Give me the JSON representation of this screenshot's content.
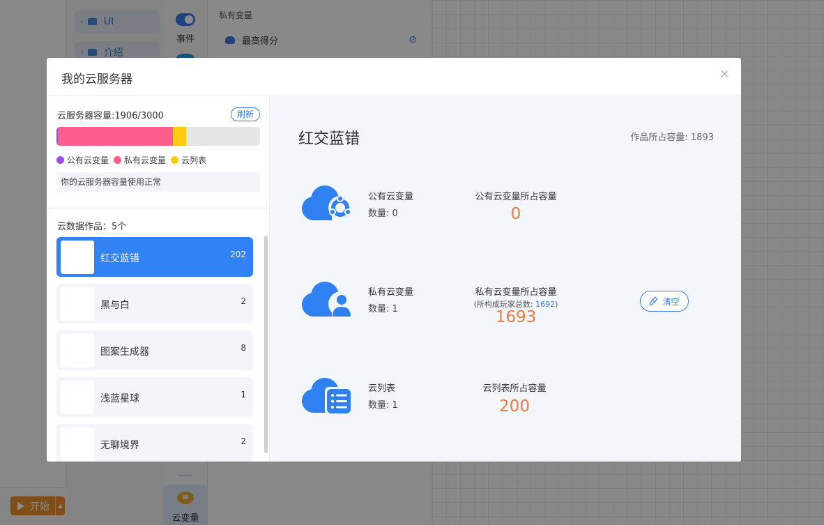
{
  "background": {
    "tree": [
      {
        "label": "UI"
      },
      {
        "label": "介绍"
      }
    ],
    "categories": {
      "event_label": "事件",
      "cloud_label": "云变量"
    },
    "blocks": {
      "heading": "私有变量",
      "variable_name": "最高得分"
    },
    "start_button": "开始"
  },
  "modal": {
    "title": "我的云服务器",
    "close_glyph": "×",
    "capacity": {
      "label": "云服务器容量:1906/3000",
      "used": 1906,
      "total": 3000,
      "segments": [
        {
          "name": "公有云变量",
          "value": 0,
          "color": "#9b4dea"
        },
        {
          "name": "私有云变量",
          "value": 1693,
          "color": "#fd5d8c"
        },
        {
          "name": "云列表",
          "value": 200,
          "color": "#ffcb12"
        }
      ],
      "refresh_label": "刷新",
      "status": "你的云服务器容量使用正常"
    },
    "works_label": "云数据作品：5个",
    "works": [
      {
        "name": "红交蓝错",
        "count": "202",
        "active": true
      },
      {
        "name": "黑与白",
        "count": "2",
        "active": false
      },
      {
        "name": "图案生成器",
        "count": "8",
        "active": false
      },
      {
        "name": "浅蓝星球",
        "count": "1",
        "active": false
      },
      {
        "name": "无聊境界",
        "count": "2",
        "active": false
      }
    ],
    "detail": {
      "title": "红交蓝错",
      "size_label": "作品所占容量: 1893",
      "rows": [
        {
          "name": "公有云变量",
          "count": "数量: 0",
          "metric": "公有云变量所占容量",
          "value": "0"
        },
        {
          "name": "私有云变量",
          "count": "数量: 1",
          "metric": "私有云变量所占容量",
          "sub_prefix": "(所构成玩家总数: ",
          "sub_value": "1692",
          "sub_suffix": ")",
          "value": "1693"
        },
        {
          "name": "云列表",
          "count": "数量: 1",
          "metric": "云列表所占容量",
          "value": "200"
        }
      ],
      "clear_label": "清空"
    }
  }
}
